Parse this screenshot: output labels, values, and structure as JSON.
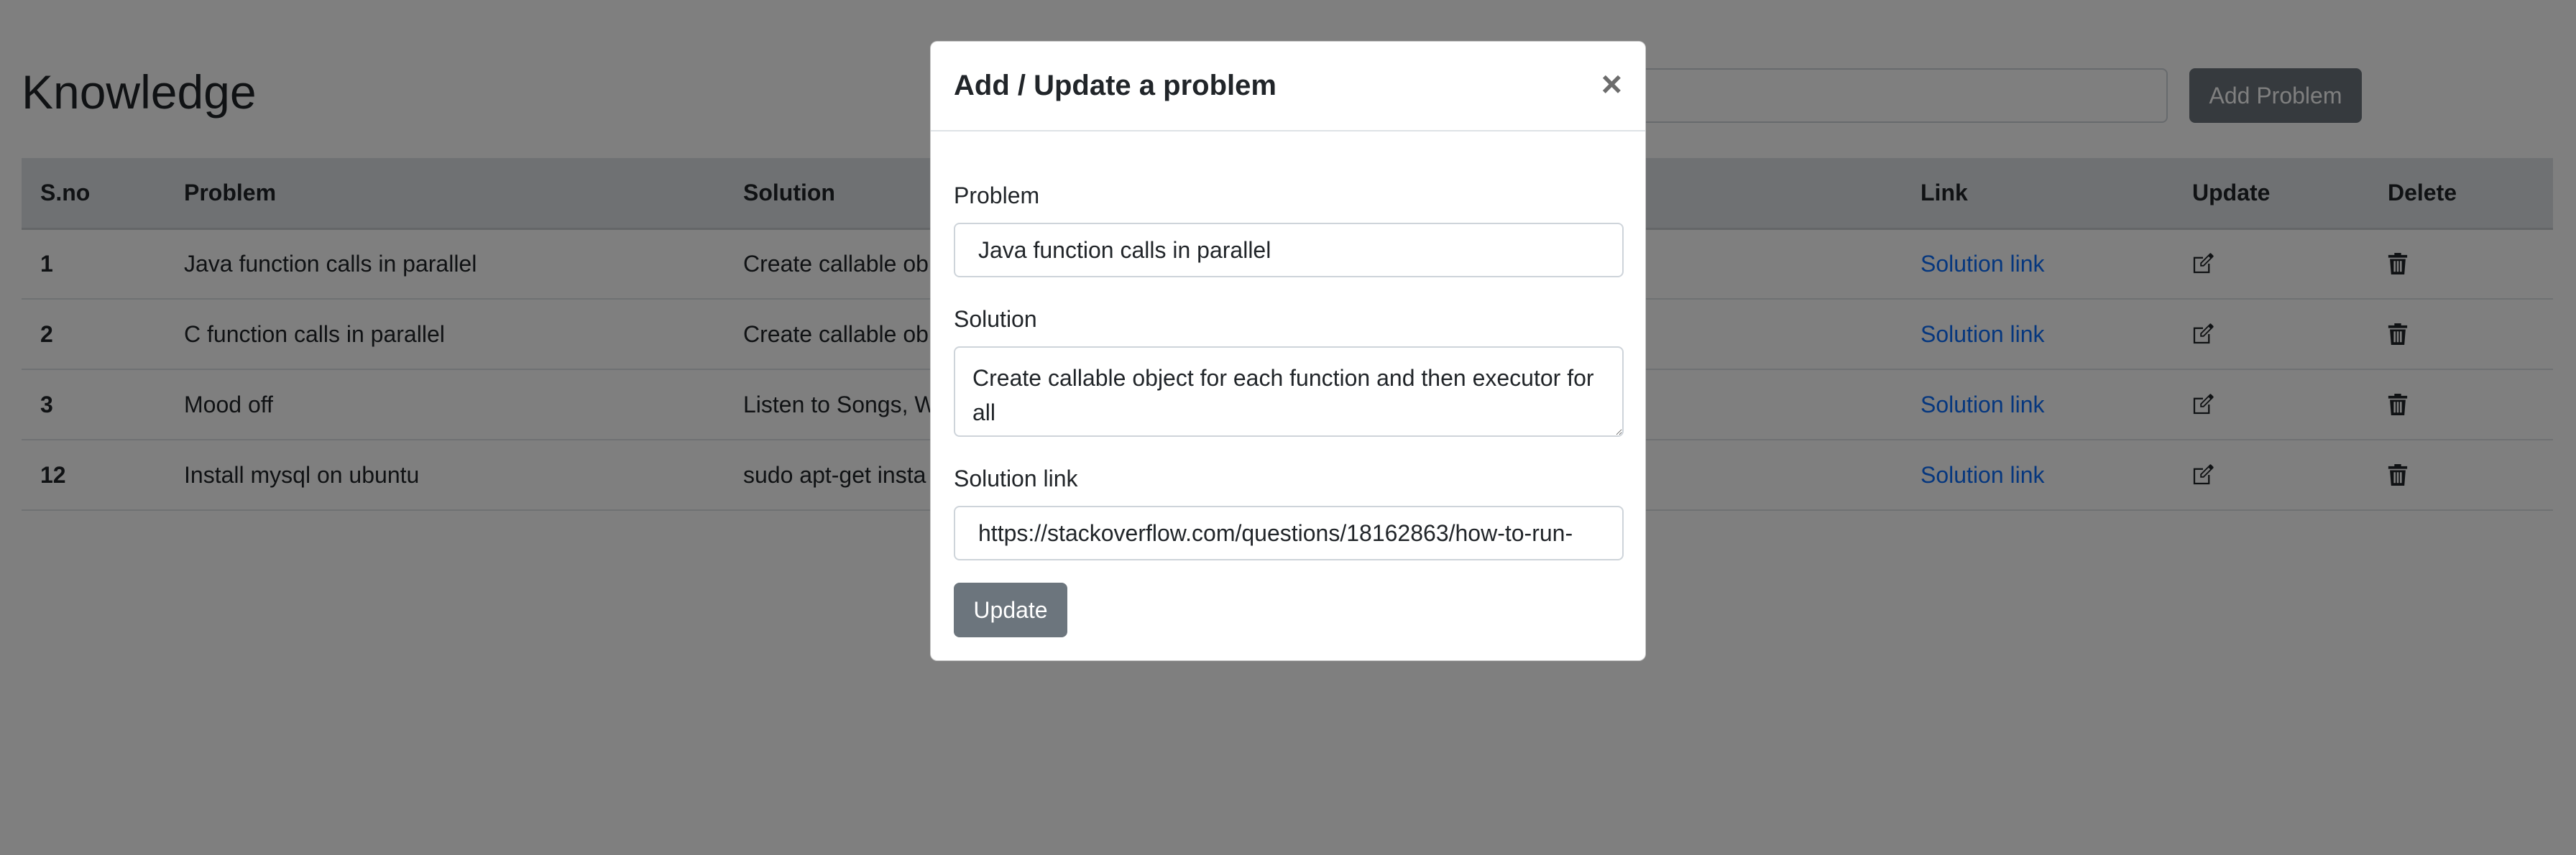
{
  "app": {
    "title": "Knowledge",
    "add_button_label": "Add Problem"
  },
  "table": {
    "headers": [
      "S.no",
      "Problem",
      "Solution",
      "Link",
      "Update",
      "Delete"
    ],
    "rows": [
      {
        "sno": "1",
        "problem": "Java function calls in parallel",
        "solution": "Create callable ob",
        "link": "Solution link"
      },
      {
        "sno": "2",
        "problem": "C function calls in parallel",
        "solution": "Create callable ob",
        "link": "Solution link"
      },
      {
        "sno": "3",
        "problem": "Mood off",
        "solution": "Listen to Songs, W",
        "link": "Solution link"
      },
      {
        "sno": "12",
        "problem": "Install mysql on ubuntu",
        "solution": "sudo apt-get insta",
        "link": "Solution link"
      }
    ]
  },
  "modal": {
    "title": "Add / Update a problem",
    "close_label": "×",
    "problem_label": "Problem",
    "problem_value": "Java function calls in parallel",
    "solution_label": "Solution",
    "solution_value": "Create callable object for each function and then executor for all",
    "link_label": "Solution link",
    "link_value": "https://stackoverflow.com/questions/18162863/how-to-run-",
    "update_label": "Update"
  },
  "icons": {
    "update": "pencil-square-icon",
    "delete": "trash-icon"
  },
  "colors": {
    "link": "#0d6efd",
    "secondary_button": "#6c757d",
    "table_header": "#dee2e6"
  }
}
